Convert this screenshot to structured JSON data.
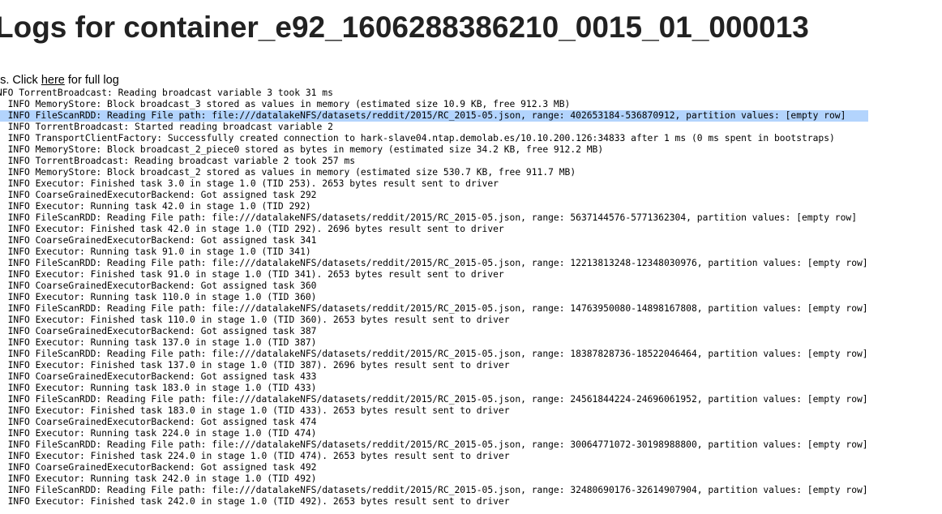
{
  "page": {
    "title": "Logs for container_e92_1606288386210_0015_01_000013",
    "note_prefix": "es. Click ",
    "note_link": "here",
    "note_suffix": " for full log"
  },
  "log": {
    "lines": [
      "NFO TorrentBroadcast: Reading broadcast variable 3 took 31 ms",
      "  INFO MemoryStore: Block broadcast_3 stored as values in memory (estimated size 10.9 KB, free 912.3 MB)",
      "  INFO FileScanRDD: Reading File path: file:///datalakeNFS/datasets/reddit/2015/RC_2015-05.json, range: 402653184-536870912, partition values: [empty row]",
      "  INFO TorrentBroadcast: Started reading broadcast variable 2",
      "  INFO TransportClientFactory: Successfully created connection to hark-slave04.ntap.demolab.es/10.10.200.126:34833 after 1 ms (0 ms spent in bootstraps)",
      "  INFO MemoryStore: Block broadcast_2_piece0 stored as bytes in memory (estimated size 34.2 KB, free 912.2 MB)",
      "  INFO TorrentBroadcast: Reading broadcast variable 2 took 257 ms",
      "  INFO MemoryStore: Block broadcast_2 stored as values in memory (estimated size 530.7 KB, free 911.7 MB)",
      "  INFO Executor: Finished task 3.0 in stage 1.0 (TID 253). 2653 bytes result sent to driver",
      "  INFO CoarseGrainedExecutorBackend: Got assigned task 292",
      "  INFO Executor: Running task 42.0 in stage 1.0 (TID 292)",
      "  INFO FileScanRDD: Reading File path: file:///datalakeNFS/datasets/reddit/2015/RC_2015-05.json, range: 5637144576-5771362304, partition values: [empty row]",
      "  INFO Executor: Finished task 42.0 in stage 1.0 (TID 292). 2696 bytes result sent to driver",
      "  INFO CoarseGrainedExecutorBackend: Got assigned task 341",
      "  INFO Executor: Running task 91.0 in stage 1.0 (TID 341)",
      "  INFO FileScanRDD: Reading File path: file:///datalakeNFS/datasets/reddit/2015/RC_2015-05.json, range: 12213813248-12348030976, partition values: [empty row]",
      "  INFO Executor: Finished task 91.0 in stage 1.0 (TID 341). 2653 bytes result sent to driver",
      "  INFO CoarseGrainedExecutorBackend: Got assigned task 360",
      "  INFO Executor: Running task 110.0 in stage 1.0 (TID 360)",
      "  INFO FileScanRDD: Reading File path: file:///datalakeNFS/datasets/reddit/2015/RC_2015-05.json, range: 14763950080-14898167808, partition values: [empty row]",
      "  INFO Executor: Finished task 110.0 in stage 1.0 (TID 360). 2653 bytes result sent to driver",
      "  INFO CoarseGrainedExecutorBackend: Got assigned task 387",
      "  INFO Executor: Running task 137.0 in stage 1.0 (TID 387)",
      "  INFO FileScanRDD: Reading File path: file:///datalakeNFS/datasets/reddit/2015/RC_2015-05.json, range: 18387828736-18522046464, partition values: [empty row]",
      "  INFO Executor: Finished task 137.0 in stage 1.0 (TID 387). 2696 bytes result sent to driver",
      "  INFO CoarseGrainedExecutorBackend: Got assigned task 433",
      "  INFO Executor: Running task 183.0 in stage 1.0 (TID 433)",
      "  INFO FileScanRDD: Reading File path: file:///datalakeNFS/datasets/reddit/2015/RC_2015-05.json, range: 24561844224-24696061952, partition values: [empty row]",
      "  INFO Executor: Finished task 183.0 in stage 1.0 (TID 433). 2653 bytes result sent to driver",
      "  INFO CoarseGrainedExecutorBackend: Got assigned task 474",
      "  INFO Executor: Running task 224.0 in stage 1.0 (TID 474)",
      "  INFO FileScanRDD: Reading File path: file:///datalakeNFS/datasets/reddit/2015/RC_2015-05.json, range: 30064771072-30198988800, partition values: [empty row]",
      "  INFO Executor: Finished task 224.0 in stage 1.0 (TID 474). 2653 bytes result sent to driver",
      "  INFO CoarseGrainedExecutorBackend: Got assigned task 492",
      "  INFO Executor: Running task 242.0 in stage 1.0 (TID 492)",
      "  INFO FileScanRDD: Reading File path: file:///datalakeNFS/datasets/reddit/2015/RC_2015-05.json, range: 32480690176-32614907904, partition values: [empty row]",
      "  INFO Executor: Finished task 242.0 in stage 1.0 (TID 492). 2653 bytes result sent to driver"
    ],
    "selected_line": 2
  },
  "colors": {
    "title_text": "#222222",
    "selection_highlight": "#b3d4fd"
  }
}
